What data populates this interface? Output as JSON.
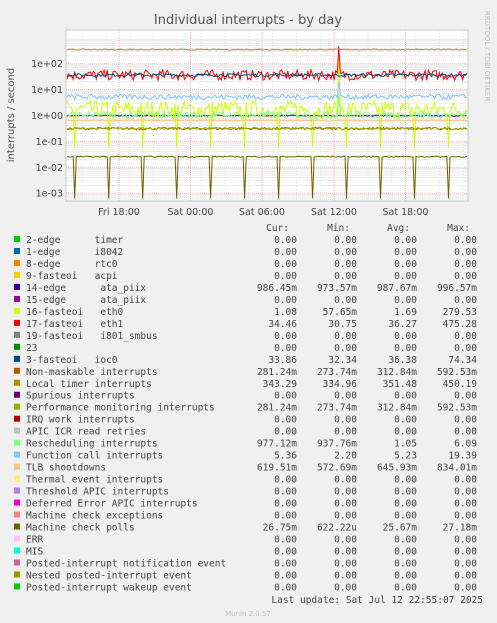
{
  "chart_data": {
    "type": "line",
    "title": "Individual interrupts - by day",
    "ylabel": "interrupts / second",
    "yscale": "log",
    "ylim": [
      0.0005,
      2000
    ],
    "yticks": [
      "1e+02",
      "1e+01",
      "1e+00",
      "1e-01",
      "1e-02",
      "1e-03"
    ],
    "xticks": [
      "Fri 18:00",
      "Sat 00:00",
      "Sat 06:00",
      "Sat 12:00",
      "Sat 18:00"
    ],
    "side_label": "RRDTOOL / TOBI OETIKER",
    "grid": true,
    "columns": [
      "Cur:",
      "Min:",
      "Avg:",
      "Max:"
    ],
    "series": [
      {
        "name": "2-edge      timer",
        "color": "#00cc00",
        "cur": "0.00",
        "min": "0.00",
        "avg": "0.00",
        "max": "0.00"
      },
      {
        "name": "1-edge      i8042",
        "color": "#0066b3",
        "cur": "0.00",
        "min": "0.00",
        "avg": "0.00",
        "max": "0.00"
      },
      {
        "name": "8-edge      rtc0",
        "color": "#ff8000",
        "cur": "0.00",
        "min": "0.00",
        "avg": "0.00",
        "max": "0.00"
      },
      {
        "name": "9-fasteoi   acpi",
        "color": "#ffcc00",
        "cur": "0.00",
        "min": "0.00",
        "avg": "0.00",
        "max": "0.00"
      },
      {
        "name": "14-edge      ata_piix",
        "color": "#330099",
        "cur": "986.45m",
        "min": "973.57m",
        "avg": "987.67m",
        "max": "996.57m"
      },
      {
        "name": "15-edge      ata_piix",
        "color": "#990099",
        "cur": "0.00",
        "min": "0.00",
        "avg": "0.00",
        "max": "0.00"
      },
      {
        "name": "16-fasteoi   eth0",
        "color": "#ccff00",
        "cur": "1.08",
        "min": "57.65m",
        "avg": "1.69",
        "max": "279.53"
      },
      {
        "name": "17-fasteoi   eth1",
        "color": "#ff0000",
        "cur": "34.46",
        "min": "30.75",
        "avg": "36.27",
        "max": "475.28"
      },
      {
        "name": "19-fasteoi   i801_smbus",
        "color": "#808080",
        "cur": "0.00",
        "min": "0.00",
        "avg": "0.00",
        "max": "0.00"
      },
      {
        "name": "23",
        "color": "#008f00",
        "cur": "0.00",
        "min": "0.00",
        "avg": "0.00",
        "max": "0.00"
      },
      {
        "name": "3-fasteoi   ioc0",
        "color": "#00487d",
        "cur": "33.86",
        "min": "32.34",
        "avg": "36.38",
        "max": "74.34"
      },
      {
        "name": "Non-maskable interrupts",
        "color": "#b35a00",
        "cur": "281.24m",
        "min": "273.74m",
        "avg": "312.84m",
        "max": "592.53m"
      },
      {
        "name": "Local timer interrupts",
        "color": "#b38f00",
        "cur": "343.29",
        "min": "334.96",
        "avg": "351.48",
        "max": "450.19"
      },
      {
        "name": "Spurious interrupts",
        "color": "#6b006b",
        "cur": "0.00",
        "min": "0.00",
        "avg": "0.00",
        "max": "0.00"
      },
      {
        "name": "Performance monitoring interrupts",
        "color": "#8fb300",
        "cur": "281.24m",
        "min": "273.74m",
        "avg": "312.84m",
        "max": "592.53m"
      },
      {
        "name": "IRQ work interrupts",
        "color": "#b30000",
        "cur": "0.00",
        "min": "0.00",
        "avg": "0.00",
        "max": "0.00"
      },
      {
        "name": "APIC ICR read retries",
        "color": "#bebebe",
        "cur": "0.00",
        "min": "0.00",
        "avg": "0.00",
        "max": "0.00"
      },
      {
        "name": "Rescheduling interrupts",
        "color": "#80ff80",
        "cur": "977.12m",
        "min": "937.76m",
        "avg": "1.05",
        "max": "6.09"
      },
      {
        "name": "Function call interrupts",
        "color": "#80c9ff",
        "cur": "5.36",
        "min": "2.20",
        "avg": "5.23",
        "max": "19.39"
      },
      {
        "name": "TLB shootdowns",
        "color": "#ffc080",
        "cur": "619.51m",
        "min": "572.69m",
        "avg": "645.93m",
        "max": "834.01m"
      },
      {
        "name": "Thermal event interrupts",
        "color": "#ffe680",
        "cur": "0.00",
        "min": "0.00",
        "avg": "0.00",
        "max": "0.00"
      },
      {
        "name": "Threshold APIC interrupts",
        "color": "#aa80ff",
        "cur": "0.00",
        "min": "0.00",
        "avg": "0.00",
        "max": "0.00"
      },
      {
        "name": "Deferred Error APIC interrupts",
        "color": "#ee00cc",
        "cur": "0.00",
        "min": "0.00",
        "avg": "0.00",
        "max": "0.00"
      },
      {
        "name": "Machine check exceptions",
        "color": "#ff8080",
        "cur": "0.00",
        "min": "0.00",
        "avg": "0.00",
        "max": "0.00"
      },
      {
        "name": "Machine check polls",
        "color": "#666600",
        "cur": "26.75m",
        "min": "622.22u",
        "avg": "25.67m",
        "max": "27.18m"
      },
      {
        "name": "ERR",
        "color": "#ffbfff",
        "cur": "0.00",
        "min": "0.00",
        "avg": "0.00",
        "max": "0.00"
      },
      {
        "name": "MIS",
        "color": "#00ffcc",
        "cur": "0.00",
        "min": "0.00",
        "avg": "0.00",
        "max": "0.00"
      },
      {
        "name": "Posted-interrupt notification event",
        "color": "#cc6699",
        "cur": "0.00",
        "min": "0.00",
        "avg": "0.00",
        "max": "0.00"
      },
      {
        "name": "Nested posted-interrupt event",
        "color": "#999900",
        "cur": "0.00",
        "min": "0.00",
        "avg": "0.00",
        "max": "0.00"
      },
      {
        "name": "Posted-interrupt wakeup event",
        "color": "#00cc00",
        "cur": "0.00",
        "min": "0.00",
        "avg": "0.00",
        "max": "0.00"
      }
    ],
    "last_update": "Last update: Sat Jul 12 22:55:07 2025",
    "footer": "Munin 2.0.57"
  }
}
